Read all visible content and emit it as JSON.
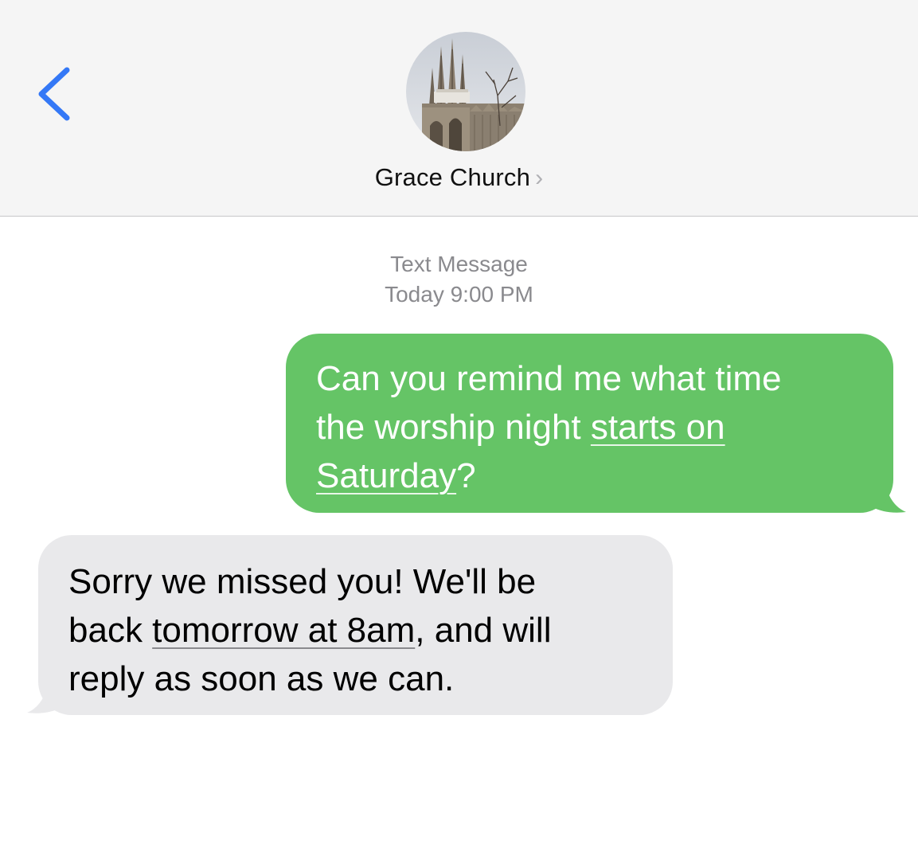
{
  "header": {
    "back_icon": "chevron-left-icon",
    "avatar_icon": "church-photo-avatar",
    "contact_name": "Grace Church",
    "contact_chevron": "›"
  },
  "conversation": {
    "service_label": "Text Message",
    "timestamp_day": "Today",
    "timestamp_time": "9:00 PM"
  },
  "messages": [
    {
      "direction": "sent",
      "lines": [
        {
          "text": "Can you remind me what time"
        },
        {
          "pre": "the worship night ",
          "link": "starts on"
        },
        {
          "link": "Saturday",
          "post": "?"
        }
      ]
    },
    {
      "direction": "received",
      "lines": [
        {
          "text": "Sorry we missed you! We'll be"
        },
        {
          "pre": "back ",
          "link": "tomorrow at 8am",
          "post": ", and will"
        },
        {
          "text": "reply as soon as we can."
        }
      ]
    }
  ],
  "colors": {
    "accent_blue": "#3478f6",
    "sent_bubble": "#65c466",
    "received_bubble": "#e9e9eb",
    "header_bg": "#f5f5f5",
    "meta_gray": "#8a8a8e"
  }
}
